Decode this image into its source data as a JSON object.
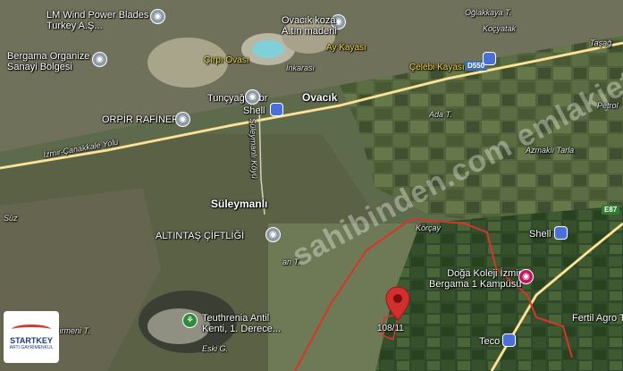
{
  "map": {
    "places": {
      "lm_wind": "LM Wind Power Blades\nTurkey A.Ş...",
      "ovacik_koza": "Ovacık koza\nA.tın madeni",
      "ogl_kkaya": "Oğlakkaya T.",
      "kocyatak": "Koçyatak",
      "tasagil": "Taşağ",
      "bergama_osb": "Bergama Organize\nSanayi Bölgesi",
      "cirpi_ovasi": "Çırpı Ovası",
      "ay_kayasi": "Ay Kayası",
      "inkarasi": "İnkarası",
      "celebi_kayasi": "Çelebi Kayası",
      "tuncyag": "Tunçyağ Fabr",
      "ovacik": "Ovacık",
      "shell1": "Shell",
      "petrol": "Petrol",
      "orpir": "ORPİR RAFİNERİ",
      "ada_t": "Ada T.",
      "azmakli": "Azmaklı Tarla",
      "suleymanli_koyu": "Süleymanlı Köyü",
      "izmir_road": "İzmir-Çanakkale Yolu",
      "suleymanli": "Süleymanlı",
      "suz": "Süz",
      "korcay": "Körçay",
      "shell2": "Shell",
      "altintas": "ALTINTAŞ ÇİFTLİĞİ",
      "an_t": "an T.",
      "doga_koleji": "Doğa Koleji İzmir\nBergama 1 Kampüsü",
      "fertil": "Fertil Agro T",
      "teuthrenia": "Teuthrenia Antil\nKenti, 1. Derece...",
      "eski": "Eski G.",
      "dirmeni": "Dirmeni T.",
      "teco": "Teco"
    },
    "road_badges": {
      "d550": "D550",
      "e87": "E87"
    },
    "parcel_label": "108/11",
    "watermark": "sahibinden.com emlakjet.com",
    "logo": {
      "name": "STARTKEY",
      "sub": "ARTI GAYRİMENKUL"
    }
  }
}
